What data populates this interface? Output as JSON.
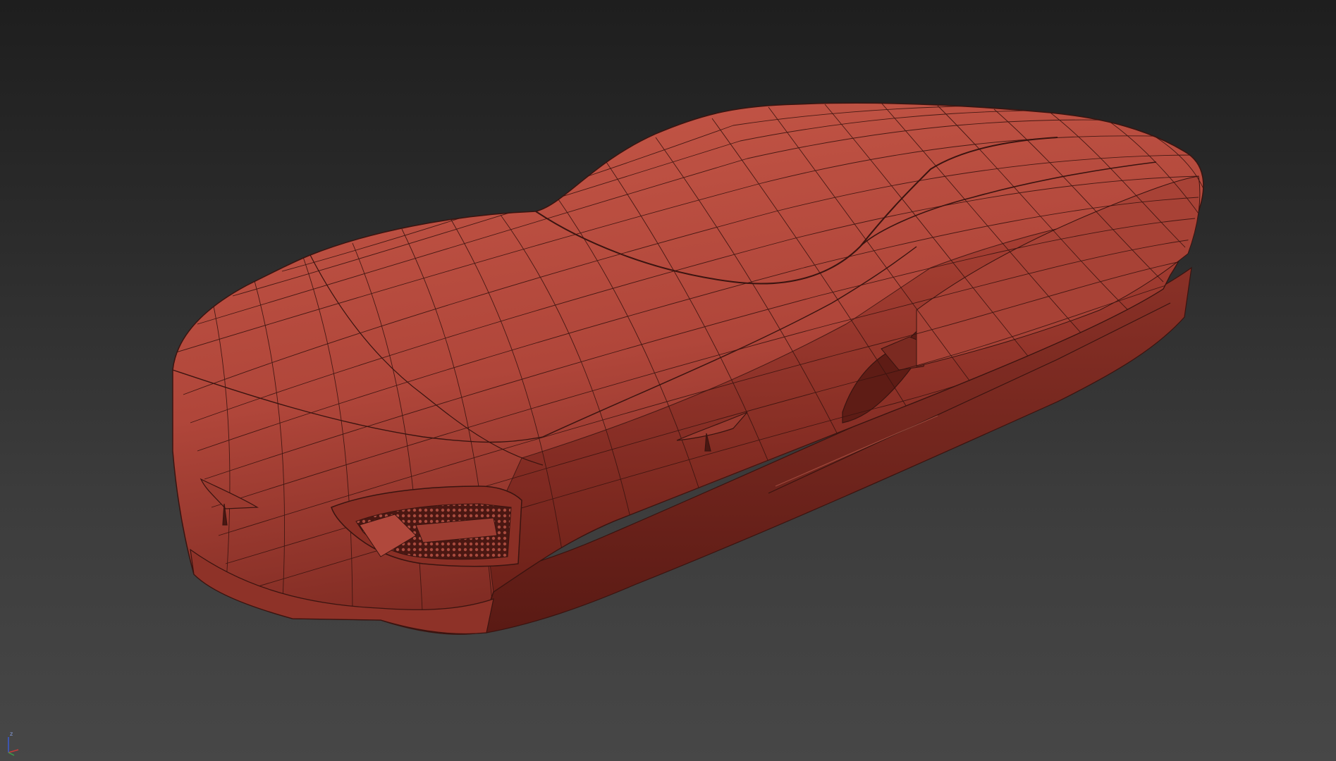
{
  "viewport": {
    "background_top": "#1e1e1e",
    "background_bottom": "#474747",
    "model": {
      "name_icon": "car-wireframe-model",
      "body_color": "#b5483c",
      "shadow_color": "#6e2019",
      "highlight_color": "#c85a4b",
      "wire_color": "#3a1410",
      "display_mode": "shaded-with-edged-faces"
    },
    "axis_gizmo": {
      "icon": "axis-tripod-icon",
      "label_z": "z",
      "colors": {
        "x": "#c83a3a",
        "y": "#3aa04a",
        "z": "#3a5ad0"
      }
    }
  }
}
